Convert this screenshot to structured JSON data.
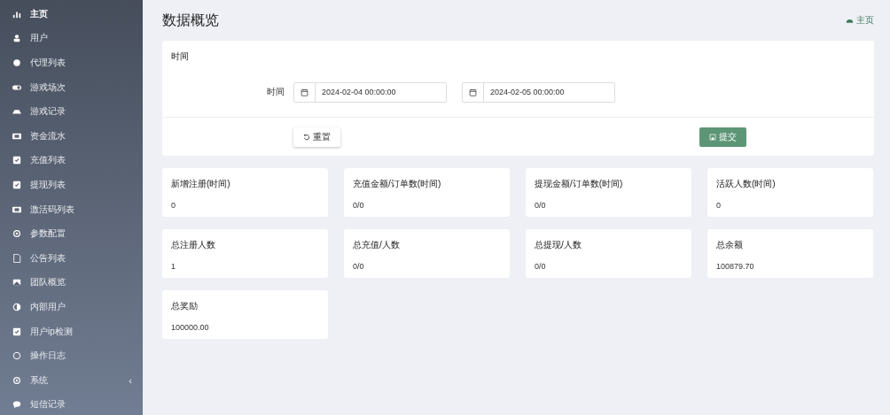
{
  "sidebar": {
    "items": [
      {
        "label": "主页",
        "selected": true
      },
      {
        "label": "用户",
        "selected": false
      },
      {
        "label": "代理列表",
        "selected": false
      },
      {
        "label": "游戏场次",
        "selected": false
      },
      {
        "label": "游戏记录",
        "selected": false
      },
      {
        "label": "资金流水",
        "selected": false
      },
      {
        "label": "充值列表",
        "selected": false
      },
      {
        "label": "提现列表",
        "selected": false
      },
      {
        "label": "激活码列表",
        "selected": false
      },
      {
        "label": "参数配置",
        "selected": false
      },
      {
        "label": "公告列表",
        "selected": false
      },
      {
        "label": "团队概览",
        "selected": false
      },
      {
        "label": "内部用户",
        "selected": false
      },
      {
        "label": "用户ip检测",
        "selected": false
      },
      {
        "label": "操作日志",
        "selected": false
      },
      {
        "label": "系统",
        "selected": false,
        "expand_glyph": "‹"
      },
      {
        "label": "短信记录",
        "selected": false
      }
    ]
  },
  "page": {
    "title": "数据概览",
    "breadcrumb": "主页"
  },
  "filter": {
    "title": "时间",
    "field_label": "时间",
    "start": "2024-02-04 00:00:00",
    "end": "2024-02-05 00:00:00",
    "reset_button": "重置",
    "submit_button": "提交"
  },
  "stats": [
    {
      "label": "新增注册(时间)",
      "value": "0"
    },
    {
      "label": "充值金额/订单数(时间)",
      "value": "0/0"
    },
    {
      "label": "提现金额/订单数(时间)",
      "value": "0/0"
    },
    {
      "label": "活跃人数(时间)",
      "value": "0"
    },
    {
      "label": "总注册人数",
      "value": "1"
    },
    {
      "label": "总充值/人数",
      "value": "0/0"
    },
    {
      "label": "总提现/人数",
      "value": "0/0"
    },
    {
      "label": "总余额",
      "value": "100879.70"
    },
    {
      "label": "总奖励",
      "value": "100000.00"
    }
  ]
}
